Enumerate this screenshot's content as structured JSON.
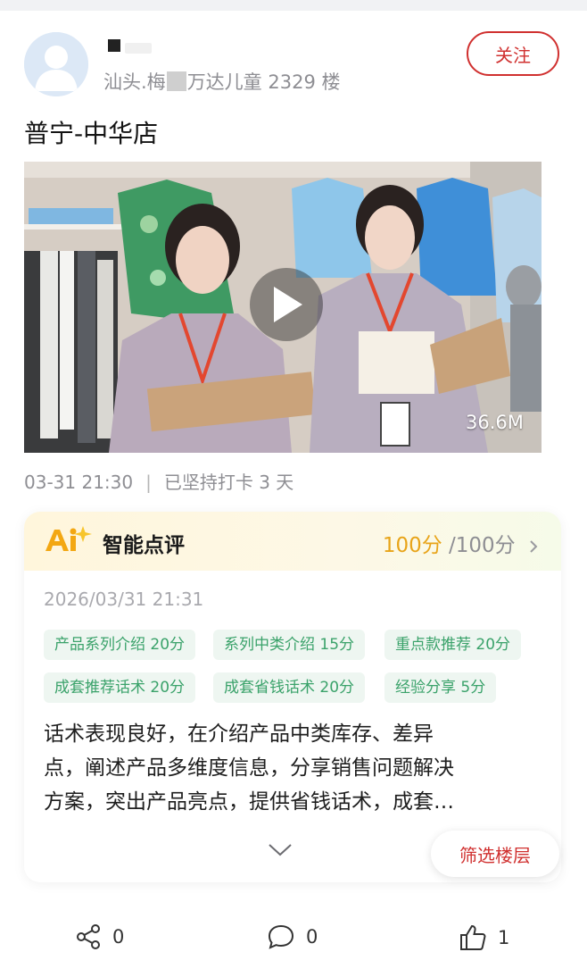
{
  "post": {
    "location_prefix": "汕头.梅",
    "location_suffix": "万达儿童",
    "floor": "2329 楼",
    "follow_label": "关注",
    "title": "普宁-中华店",
    "video_size": "36.6M",
    "date": "03-31 21:30",
    "streak": "已坚持打卡 3 天"
  },
  "ai_review": {
    "title": "智能点评",
    "score": "100分",
    "total": "/100分",
    "time": "2026/03/31 21:31",
    "tags": [
      "产品系列介绍 20分",
      "系列中类介绍 15分",
      "重点款推荐 20分",
      "成套推荐话术 20分",
      "成套省钱话术 20分",
      "经验分享 5分"
    ],
    "text_lines": [
      "话术表现良好，在介绍产品中类库存、差异",
      "点，阐述产品多维度信息，分享销售问题解决",
      "方案，突出产品亮点，提供省钱话术，成套…"
    ]
  },
  "filter_label": "筛选楼层",
  "actions": {
    "share_count": "0",
    "comment_count": "0",
    "like_count": "1"
  },
  "colors": {
    "brand_red": "#d0302f",
    "score_gold": "#e8a419",
    "tag_green": "#3aa26a"
  },
  "icons": [
    "user-avatar-icon",
    "play-icon",
    "ai-logo-icon",
    "chevron-right-icon",
    "chevron-down-icon",
    "share-icon",
    "comment-icon",
    "like-icon"
  ]
}
